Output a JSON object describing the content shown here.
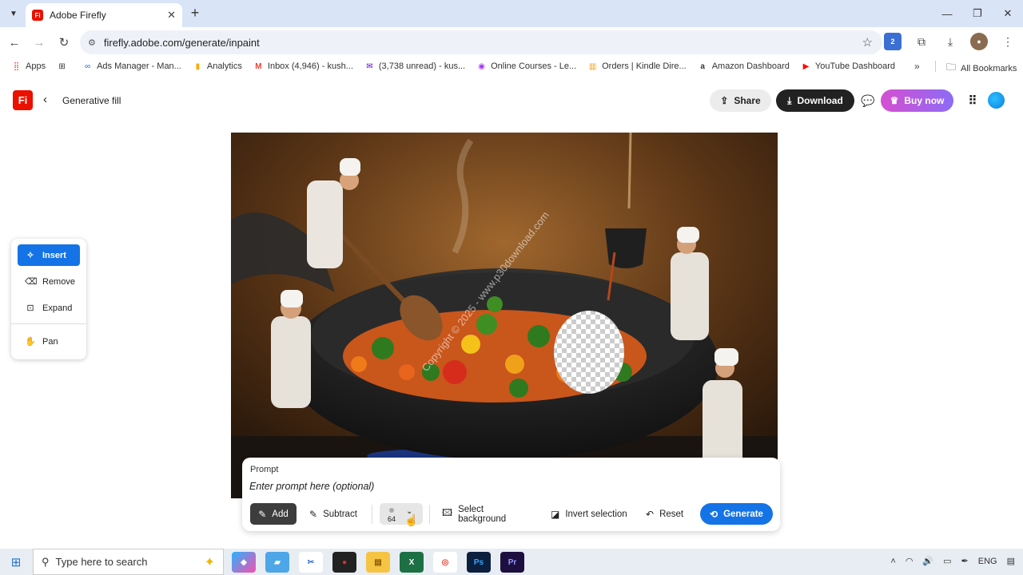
{
  "browser": {
    "tab_title": "Adobe Firefly",
    "url": "firefly.adobe.com/generate/inpaint",
    "bookmarks": [
      {
        "label": "Apps"
      },
      {
        "label": "Ads Manager - Man..."
      },
      {
        "label": "Analytics"
      },
      {
        "label": "Inbox (4,946) - kush..."
      },
      {
        "label": "(3,738 unread) - kus..."
      },
      {
        "label": "Online Courses - Le..."
      },
      {
        "label": "Orders | Kindle Dire..."
      },
      {
        "label": "Amazon Dashboard"
      },
      {
        "label": "YouTube Dashboard"
      }
    ],
    "all_bookmarks": "All Bookmarks",
    "ext_badge": "2"
  },
  "app": {
    "logo": "Fi",
    "title": "Generative fill",
    "share": "Share",
    "download": "Download",
    "buy_now": "Buy now"
  },
  "tools": {
    "insert": "Insert",
    "remove": "Remove",
    "expand": "Expand",
    "pan": "Pan",
    "active": "insert"
  },
  "image": {
    "watermark": "Copyright © 2025 - www.p30download.com"
  },
  "prompt": {
    "label": "Prompt",
    "placeholder": "Enter prompt here (optional)",
    "add": "Add",
    "subtract": "Subtract",
    "brush_size": "64",
    "select_background": "Select background",
    "invert_selection": "Invert selection",
    "reset": "Reset",
    "generate": "Generate"
  },
  "taskbar": {
    "search_placeholder": "Type here to search",
    "lang": "ENG"
  },
  "colors": {
    "accent": "#1473e6",
    "firefly_red": "#eb1000",
    "buy_gradient_start": "#d64fd1",
    "buy_gradient_end": "#8b6cf6"
  }
}
